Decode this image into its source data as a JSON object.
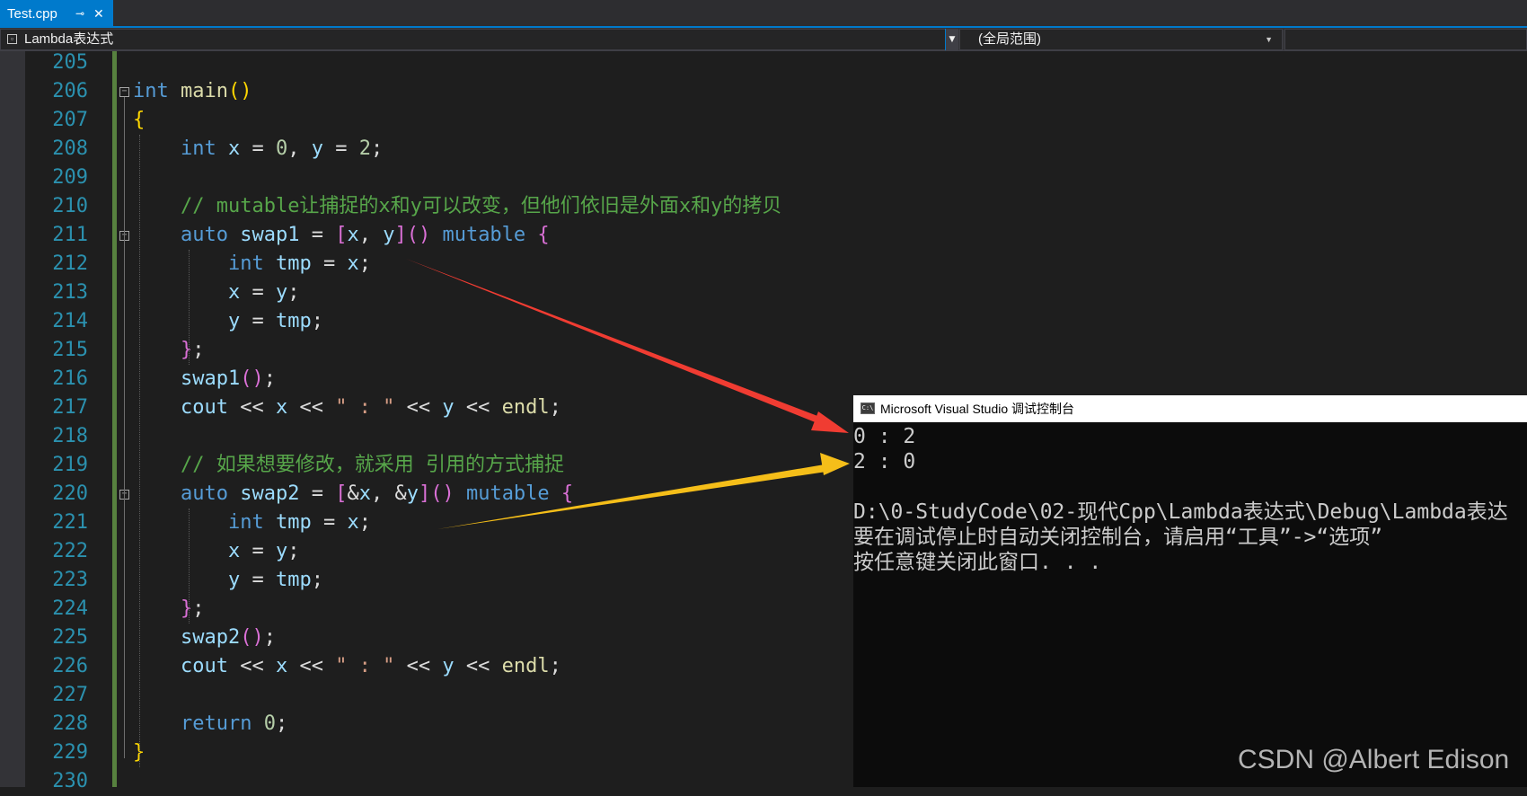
{
  "tab": {
    "title": "Test.cpp",
    "pin_glyph": "⊸",
    "close_glyph": "✕"
  },
  "navbar": {
    "left_value": "Lambda表达式",
    "right_value": "(全局范围)"
  },
  "editor": {
    "lines": [
      {
        "n": "205",
        "tokens": []
      },
      {
        "n": "206",
        "tokens": [
          [
            "kw",
            "int"
          ],
          [
            "p",
            " "
          ],
          [
            "fn",
            "main"
          ],
          [
            "br1",
            "()"
          ]
        ]
      },
      {
        "n": "207",
        "tokens": [
          [
            "br1",
            "{"
          ]
        ]
      },
      {
        "n": "208",
        "tokens": [
          [
            "p",
            "    "
          ],
          [
            "kw",
            "int"
          ],
          [
            "p",
            " "
          ],
          [
            "var",
            "x"
          ],
          [
            "p",
            " = "
          ],
          [
            "num",
            "0"
          ],
          [
            "p",
            ", "
          ],
          [
            "var",
            "y"
          ],
          [
            "p",
            " = "
          ],
          [
            "num",
            "2"
          ],
          [
            "p",
            ";"
          ]
        ]
      },
      {
        "n": "209",
        "tokens": []
      },
      {
        "n": "210",
        "tokens": [
          [
            "p",
            "    "
          ],
          [
            "cmt",
            "// mutable让捕捉的x和y可以改变，但他们依旧是外面x和y的拷贝"
          ]
        ]
      },
      {
        "n": "211",
        "tokens": [
          [
            "p",
            "    "
          ],
          [
            "kw",
            "auto"
          ],
          [
            "p",
            " "
          ],
          [
            "var",
            "swap1"
          ],
          [
            "p",
            " = "
          ],
          [
            "br2",
            "["
          ],
          [
            "var",
            "x"
          ],
          [
            "p",
            ", "
          ],
          [
            "var",
            "y"
          ],
          [
            "br2",
            "]"
          ],
          [
            "br2",
            "()"
          ],
          [
            "p",
            " "
          ],
          [
            "kw",
            "mutable"
          ],
          [
            "p",
            " "
          ],
          [
            "br2",
            "{"
          ]
        ]
      },
      {
        "n": "212",
        "tokens": [
          [
            "p",
            "        "
          ],
          [
            "kw",
            "int"
          ],
          [
            "p",
            " "
          ],
          [
            "var",
            "tmp"
          ],
          [
            "p",
            " = "
          ],
          [
            "var",
            "x"
          ],
          [
            "p",
            ";"
          ]
        ]
      },
      {
        "n": "213",
        "tokens": [
          [
            "p",
            "        "
          ],
          [
            "var",
            "x"
          ],
          [
            "p",
            " = "
          ],
          [
            "var",
            "y"
          ],
          [
            "p",
            ";"
          ]
        ]
      },
      {
        "n": "214",
        "tokens": [
          [
            "p",
            "        "
          ],
          [
            "var",
            "y"
          ],
          [
            "p",
            " = "
          ],
          [
            "var",
            "tmp"
          ],
          [
            "p",
            ";"
          ]
        ]
      },
      {
        "n": "215",
        "tokens": [
          [
            "p",
            "    "
          ],
          [
            "br2",
            "}"
          ],
          [
            "p",
            ";"
          ]
        ]
      },
      {
        "n": "216",
        "tokens": [
          [
            "p",
            "    "
          ],
          [
            "var",
            "swap1"
          ],
          [
            "br2",
            "()"
          ],
          [
            "p",
            ";"
          ]
        ]
      },
      {
        "n": "217",
        "tokens": [
          [
            "p",
            "    "
          ],
          [
            "var",
            "cout"
          ],
          [
            "p",
            " << "
          ],
          [
            "var",
            "x"
          ],
          [
            "p",
            " << "
          ],
          [
            "str",
            "\" : \""
          ],
          [
            "p",
            " << "
          ],
          [
            "var",
            "y"
          ],
          [
            "p",
            " << "
          ],
          [
            "fn",
            "endl"
          ],
          [
            "p",
            ";"
          ]
        ]
      },
      {
        "n": "218",
        "tokens": []
      },
      {
        "n": "219",
        "tokens": [
          [
            "p",
            "    "
          ],
          [
            "cmt",
            "// 如果想要修改，就采用 引用的方式捕捉"
          ]
        ]
      },
      {
        "n": "220",
        "tokens": [
          [
            "p",
            "    "
          ],
          [
            "kw",
            "auto"
          ],
          [
            "p",
            " "
          ],
          [
            "var",
            "swap2"
          ],
          [
            "p",
            " = "
          ],
          [
            "br2",
            "["
          ],
          [
            "p",
            "&"
          ],
          [
            "var",
            "x"
          ],
          [
            "p",
            ", &"
          ],
          [
            "var",
            "y"
          ],
          [
            "br2",
            "]"
          ],
          [
            "br2",
            "()"
          ],
          [
            "p",
            " "
          ],
          [
            "kw",
            "mutable"
          ],
          [
            "p",
            " "
          ],
          [
            "br2",
            "{"
          ]
        ]
      },
      {
        "n": "221",
        "tokens": [
          [
            "p",
            "        "
          ],
          [
            "kw",
            "int"
          ],
          [
            "p",
            " "
          ],
          [
            "var",
            "tmp"
          ],
          [
            "p",
            " = "
          ],
          [
            "var",
            "x"
          ],
          [
            "p",
            ";"
          ]
        ]
      },
      {
        "n": "222",
        "tokens": [
          [
            "p",
            "        "
          ],
          [
            "var",
            "x"
          ],
          [
            "p",
            " = "
          ],
          [
            "var",
            "y"
          ],
          [
            "p",
            ";"
          ]
        ]
      },
      {
        "n": "223",
        "tokens": [
          [
            "p",
            "        "
          ],
          [
            "var",
            "y"
          ],
          [
            "p",
            " = "
          ],
          [
            "var",
            "tmp"
          ],
          [
            "p",
            ";"
          ]
        ]
      },
      {
        "n": "224",
        "tokens": [
          [
            "p",
            "    "
          ],
          [
            "br2",
            "}"
          ],
          [
            "p",
            ";"
          ]
        ]
      },
      {
        "n": "225",
        "tokens": [
          [
            "p",
            "    "
          ],
          [
            "var",
            "swap2"
          ],
          [
            "br2",
            "()"
          ],
          [
            "p",
            ";"
          ]
        ]
      },
      {
        "n": "226",
        "tokens": [
          [
            "p",
            "    "
          ],
          [
            "var",
            "cout"
          ],
          [
            "p",
            " << "
          ],
          [
            "var",
            "x"
          ],
          [
            "p",
            " << "
          ],
          [
            "str",
            "\" : \""
          ],
          [
            "p",
            " << "
          ],
          [
            "var",
            "y"
          ],
          [
            "p",
            " << "
          ],
          [
            "fn",
            "endl"
          ],
          [
            "p",
            ";"
          ]
        ]
      },
      {
        "n": "227",
        "tokens": []
      },
      {
        "n": "228",
        "tokens": [
          [
            "p",
            "    "
          ],
          [
            "kw",
            "return"
          ],
          [
            "p",
            " "
          ],
          [
            "num",
            "0"
          ],
          [
            "p",
            ";"
          ]
        ]
      },
      {
        "n": "229",
        "tokens": [
          [
            "br1",
            "}"
          ]
        ]
      },
      {
        "n": "230",
        "tokens": []
      }
    ]
  },
  "console": {
    "title": "Microsoft Visual Studio 调试控制台",
    "icon_text": "C:\\",
    "lines": [
      "0 : 2",
      "2 : 0",
      "",
      "D:\\0-StudyCode\\02-现代Cpp\\Lambda表达式\\Debug\\Lambda表达",
      "要在调试停止时自动关闭控制台，请启用“工具”->“选项”",
      "按任意键关闭此窗口. . ."
    ]
  },
  "watermark": "CSDN @Albert Edison",
  "colors": {
    "accent": "#007acc",
    "arrow_red": "#f03c32",
    "arrow_yellow": "#f5be19",
    "change_bar": "#57813f"
  },
  "icons": {
    "tab_pin": "pin-icon",
    "tab_close": "close-icon",
    "fold": "collapse-box-icon",
    "console": "console-app-icon"
  }
}
